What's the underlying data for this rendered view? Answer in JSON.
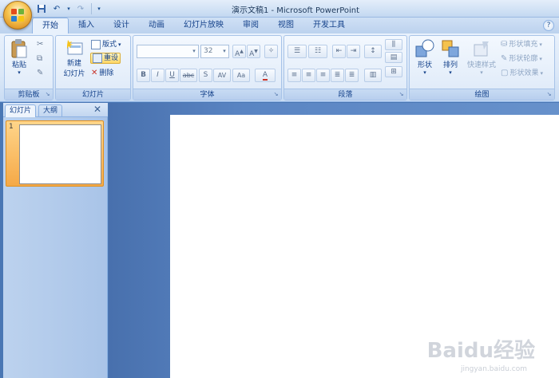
{
  "window": {
    "title": "演示文稿1 - Microsoft PowerPoint"
  },
  "tabs": [
    {
      "label": "开始",
      "active": true
    },
    {
      "label": "插入"
    },
    {
      "label": "设计"
    },
    {
      "label": "动画"
    },
    {
      "label": "幻灯片放映"
    },
    {
      "label": "审阅"
    },
    {
      "label": "视图"
    },
    {
      "label": "开发工具"
    }
  ],
  "ribbon": {
    "clipboard": {
      "label": "剪贴板",
      "paste": "粘贴"
    },
    "slides": {
      "label": "幻灯片",
      "new_slide_1": "新建",
      "new_slide_2": "幻灯片",
      "layout": "版式",
      "reset": "重设",
      "delete": "删除"
    },
    "font": {
      "label": "字体",
      "font_name": "",
      "font_size": "32",
      "bold": "B",
      "italic": "I",
      "underline": "U",
      "strike": "abc",
      "shadow": "S",
      "spacing": "AV",
      "case": "Aa"
    },
    "paragraph": {
      "label": "段落"
    },
    "drawing": {
      "label": "绘图",
      "shapes": "形状",
      "arrange": "排列",
      "quick_styles": "快速样式",
      "fill": "形状填充",
      "outline": "形状轮廓",
      "effects": "形状效果"
    }
  },
  "panel": {
    "tab_slides": "幻灯片",
    "tab_outline": "大纲",
    "slide_number": "1"
  },
  "watermark": {
    "text": "Baidu经验",
    "url": "jingyan.baidu.com"
  },
  "colors": {
    "accent": "#15428b",
    "ribbon": "#dbe8f8",
    "selected": "#f5a947"
  }
}
